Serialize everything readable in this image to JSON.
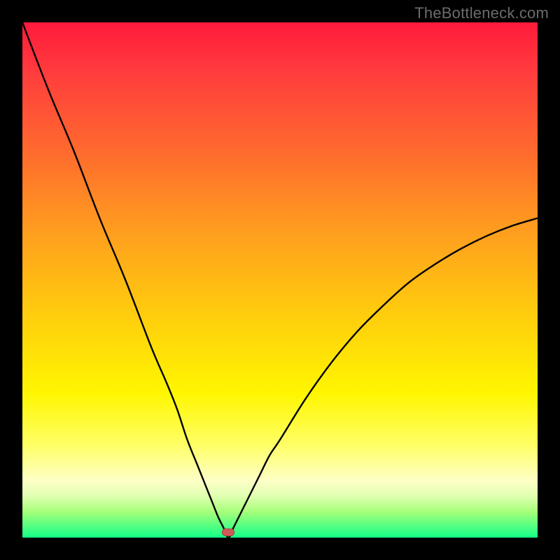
{
  "watermark": "TheBottleneck.com",
  "colors": {
    "frame": "#000000",
    "watermark": "#6b6b6b",
    "curve": "#000000",
    "marker_fill": "#cf5b58",
    "marker_stroke": "#a8423f"
  },
  "chart_data": {
    "type": "line",
    "title": "",
    "xlabel": "",
    "ylabel": "",
    "xlim": [
      0,
      100
    ],
    "ylim": [
      0,
      100
    ],
    "grid": false,
    "legend": false,
    "background_gradient": {
      "top_color": "#ff1a3c",
      "middle_color": "#fff600",
      "bottom_color": "#12ff88"
    },
    "marker": {
      "x": 40,
      "y": 1,
      "shape": "rounded-rect"
    },
    "series": [
      {
        "name": "curve",
        "x": [
          0,
          5,
          10,
          15,
          20,
          25,
          28,
          30,
          32,
          34,
          36,
          37,
          38,
          39,
          40,
          41,
          42,
          44,
          46,
          48,
          50,
          55,
          60,
          65,
          70,
          75,
          80,
          85,
          90,
          95,
          100
        ],
        "y": [
          100,
          87,
          75,
          62,
          50,
          37,
          30,
          25,
          19,
          14,
          9,
          6.5,
          4,
          2,
          0,
          2,
          4,
          8,
          12,
          16,
          19,
          27,
          34,
          40,
          45,
          49.5,
          53,
          56,
          58.5,
          60.5,
          62
        ]
      }
    ]
  }
}
